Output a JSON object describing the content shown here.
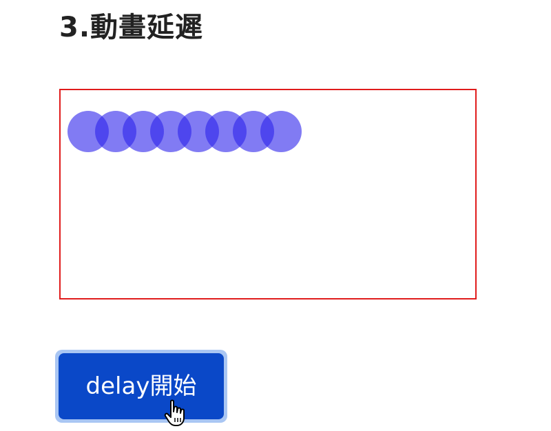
{
  "heading": {
    "text": "3.動畫延遲"
  },
  "animation_box": {
    "border_color": "#e01b1b",
    "ball_color": "#2d23eb",
    "ball_count": 8
  },
  "controls": {
    "start_button_label": "delay開始",
    "button_color": "#0a48c8",
    "focus_ring_color": "#a9c6f3"
  },
  "cursor": {
    "icon": "pointer-hand-icon"
  }
}
